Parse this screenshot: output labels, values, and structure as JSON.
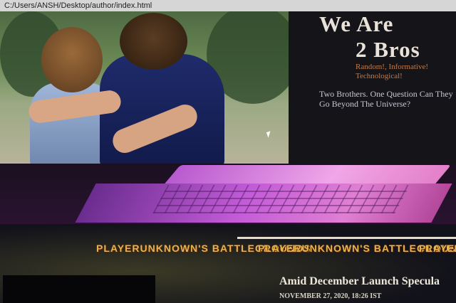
{
  "browser": {
    "url": "C:/Users/ANSH/Desktop/author/index.html"
  },
  "hero": {
    "title_line1": "We Are",
    "title_line2": "2 Bros",
    "tagline": "Random!, Informative! Technological!",
    "question": "Two Brothers. One Question Can They Go Beyond The Universe?"
  },
  "news": {
    "banner_text": "PLAYERUNKNOWN'S BATTLEGROUNDS",
    "headline": "Amid December Launch Specula",
    "dateline": "NOVEMBER 27, 2020, 18:26 IST"
  },
  "colors": {
    "accent": "#c77a45",
    "title": "#e8e2d8",
    "banner": "#e9b24b"
  }
}
